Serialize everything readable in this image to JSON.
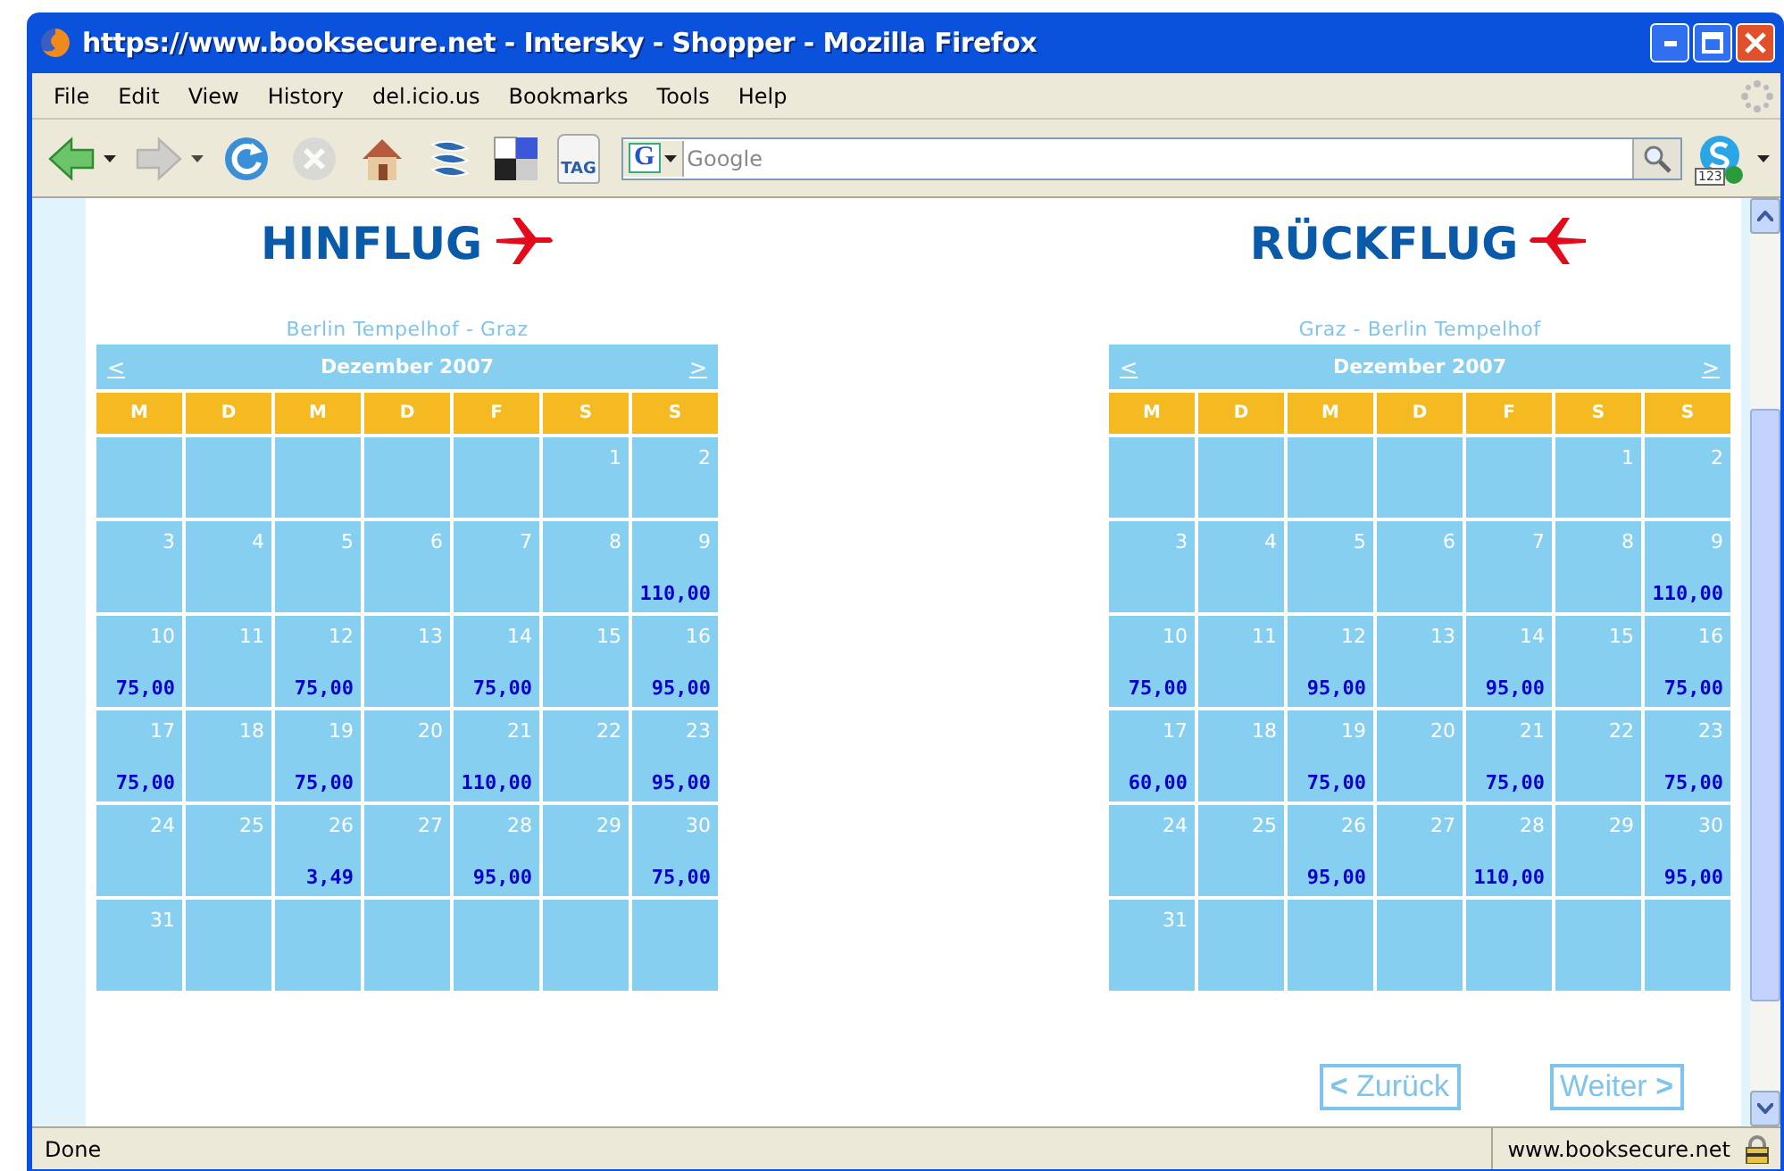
{
  "window": {
    "title": "https://www.booksecure.net - Intersky - Shopper - Mozilla Firefox"
  },
  "menu": [
    {
      "label": "File"
    },
    {
      "label": "Edit"
    },
    {
      "label": "View"
    },
    {
      "label": "History"
    },
    {
      "label": "del.icio.us"
    },
    {
      "label": "Bookmarks"
    },
    {
      "label": "Tools"
    },
    {
      "label": "Help"
    }
  ],
  "toolbar": {
    "buttons": [
      {
        "kind": "back",
        "disabled": false,
        "dropdown": true
      },
      {
        "kind": "forward",
        "disabled": true,
        "dropdown": true
      },
      {
        "kind": "reload",
        "disabled": false,
        "dropdown": false
      },
      {
        "kind": "stop",
        "disabled": true,
        "dropdown": false
      },
      {
        "kind": "home",
        "disabled": false,
        "dropdown": false
      },
      {
        "kind": "feed",
        "disabled": false,
        "dropdown": false
      },
      {
        "kind": "squares",
        "disabled": false,
        "dropdown": false
      },
      {
        "kind": "tag",
        "label": "TAG",
        "disabled": false,
        "dropdown": false
      }
    ],
    "search": {
      "engine": "G",
      "placeholder": "Google"
    },
    "addon": {
      "badge": "123"
    }
  },
  "calendars": [
    {
      "heading": "HINFLUG",
      "kind": "outbound",
      "route": "Berlin Tempelhof - Graz",
      "prev": "<",
      "month": "Dezember 2007",
      "next": ">",
      "weekdays": [
        "M",
        "D",
        "M",
        "D",
        "F",
        "S",
        "S"
      ],
      "weeks": [
        [
          {
            "kind": "blank"
          },
          {
            "kind": "blank"
          },
          {
            "kind": "blank"
          },
          {
            "kind": "blank"
          },
          {
            "kind": "blank"
          },
          {
            "kind": "day",
            "day": "1"
          },
          {
            "kind": "day",
            "day": "2"
          }
        ],
        [
          {
            "kind": "day",
            "day": "3"
          },
          {
            "kind": "day",
            "day": "4"
          },
          {
            "kind": "day",
            "day": "5"
          },
          {
            "kind": "day",
            "day": "6"
          },
          {
            "kind": "day",
            "day": "7"
          },
          {
            "kind": "day",
            "day": "8"
          },
          {
            "kind": "day",
            "day": "9",
            "price": "110,00"
          }
        ],
        [
          {
            "kind": "day",
            "day": "10",
            "price": "75,00"
          },
          {
            "kind": "day",
            "day": "11"
          },
          {
            "kind": "day",
            "day": "12",
            "price": "75,00"
          },
          {
            "kind": "day",
            "day": "13"
          },
          {
            "kind": "day",
            "day": "14",
            "price": "75,00"
          },
          {
            "kind": "day",
            "day": "15"
          },
          {
            "kind": "day",
            "day": "16",
            "price": "95,00"
          }
        ],
        [
          {
            "kind": "day",
            "day": "17",
            "price": "75,00"
          },
          {
            "kind": "day",
            "day": "18"
          },
          {
            "kind": "day",
            "day": "19",
            "price": "75,00"
          },
          {
            "kind": "day",
            "day": "20"
          },
          {
            "kind": "day",
            "day": "21",
            "price": "110,00"
          },
          {
            "kind": "day",
            "day": "22"
          },
          {
            "kind": "day",
            "day": "23",
            "price": "95,00"
          }
        ],
        [
          {
            "kind": "day",
            "day": "24"
          },
          {
            "kind": "day",
            "day": "25"
          },
          {
            "kind": "day",
            "day": "26",
            "price": "3,49"
          },
          {
            "kind": "day",
            "day": "27"
          },
          {
            "kind": "day",
            "day": "28",
            "price": "95,00"
          },
          {
            "kind": "day",
            "day": "29"
          },
          {
            "kind": "day",
            "day": "30",
            "price": "75,00"
          }
        ],
        [
          {
            "kind": "day",
            "day": "31"
          },
          {
            "kind": "blank"
          },
          {
            "kind": "blank"
          },
          {
            "kind": "blank"
          },
          {
            "kind": "blank"
          },
          {
            "kind": "blank"
          },
          {
            "kind": "blank"
          }
        ]
      ]
    },
    {
      "heading": "RÜCKFLUG",
      "kind": "return",
      "route": "Graz - Berlin Tempelhof",
      "prev": "<",
      "month": "Dezember 2007",
      "next": ">",
      "weekdays": [
        "M",
        "D",
        "M",
        "D",
        "F",
        "S",
        "S"
      ],
      "weeks": [
        [
          {
            "kind": "blank"
          },
          {
            "kind": "blank"
          },
          {
            "kind": "blank"
          },
          {
            "kind": "blank"
          },
          {
            "kind": "blank"
          },
          {
            "kind": "day",
            "day": "1"
          },
          {
            "kind": "day",
            "day": "2"
          }
        ],
        [
          {
            "kind": "day",
            "day": "3"
          },
          {
            "kind": "day",
            "day": "4"
          },
          {
            "kind": "day",
            "day": "5"
          },
          {
            "kind": "day",
            "day": "6"
          },
          {
            "kind": "day",
            "day": "7"
          },
          {
            "kind": "day",
            "day": "8"
          },
          {
            "kind": "day",
            "day": "9",
            "price": "110,00"
          }
        ],
        [
          {
            "kind": "day",
            "day": "10",
            "price": "75,00"
          },
          {
            "kind": "day",
            "day": "11"
          },
          {
            "kind": "day",
            "day": "12",
            "price": "95,00"
          },
          {
            "kind": "day",
            "day": "13"
          },
          {
            "kind": "day",
            "day": "14",
            "price": "95,00"
          },
          {
            "kind": "day",
            "day": "15"
          },
          {
            "kind": "day",
            "day": "16",
            "price": "75,00"
          }
        ],
        [
          {
            "kind": "day",
            "day": "17",
            "price": "60,00"
          },
          {
            "kind": "day",
            "day": "18"
          },
          {
            "kind": "day",
            "day": "19",
            "price": "75,00"
          },
          {
            "kind": "day",
            "day": "20"
          },
          {
            "kind": "day",
            "day": "21",
            "price": "75,00"
          },
          {
            "kind": "day",
            "day": "22"
          },
          {
            "kind": "day",
            "day": "23",
            "price": "75,00"
          }
        ],
        [
          {
            "kind": "day",
            "day": "24"
          },
          {
            "kind": "day",
            "day": "25"
          },
          {
            "kind": "day",
            "day": "26",
            "price": "95,00"
          },
          {
            "kind": "day",
            "day": "27"
          },
          {
            "kind": "day",
            "day": "28",
            "price": "110,00"
          },
          {
            "kind": "day",
            "day": "29"
          },
          {
            "kind": "day",
            "day": "30",
            "price": "95,00"
          }
        ],
        [
          {
            "kind": "day",
            "day": "31"
          },
          {
            "kind": "blank"
          },
          {
            "kind": "blank"
          },
          {
            "kind": "blank"
          },
          {
            "kind": "blank"
          },
          {
            "kind": "blank"
          },
          {
            "kind": "blank"
          }
        ]
      ]
    }
  ],
  "buttons": [
    {
      "label": "**<** Zurück"
    },
    {
      "label": "Weiter **>**"
    }
  ],
  "status_bar": {
    "text": "Done",
    "site": "www.booksecure.net"
  }
}
